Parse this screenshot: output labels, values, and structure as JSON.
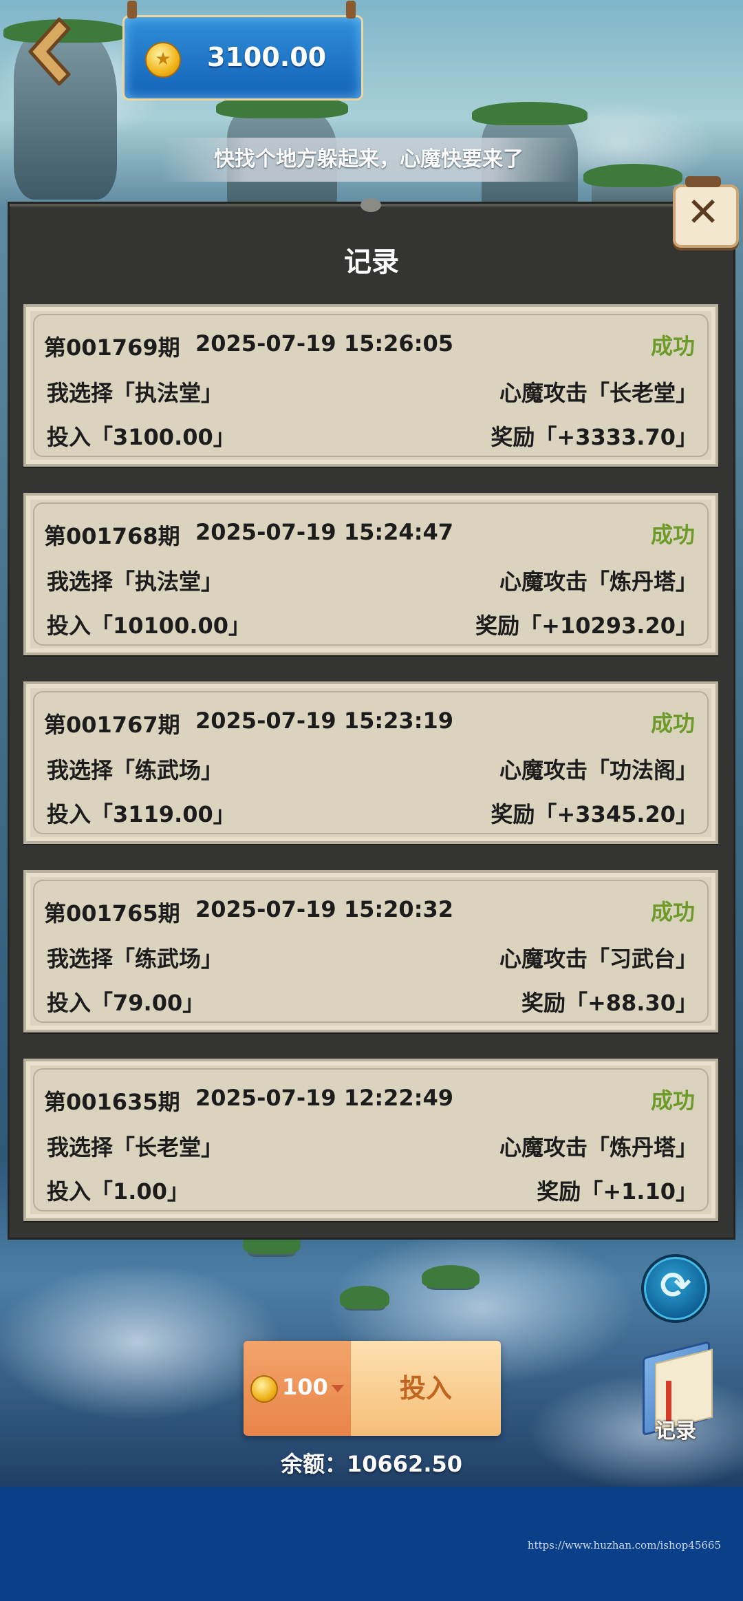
{
  "header": {
    "coin_balance": "3100.00",
    "hint": "快找个地方躲起来，心魔快要来了"
  },
  "panel": {
    "title": "记录",
    "close_label": "✕"
  },
  "records": [
    {
      "period": "第001769期",
      "time": "2025-07-19 15:26:05",
      "status": "成功",
      "choice": "我选择「执法堂」",
      "attack": "心魔攻击「长老堂」",
      "bet": "投入「3100.00」",
      "reward": "奖励「+3333.70」"
    },
    {
      "period": "第001768期",
      "time": "2025-07-19 15:24:47",
      "status": "成功",
      "choice": "我选择「执法堂」",
      "attack": "心魔攻击「炼丹塔」",
      "bet": "投入「10100.00」",
      "reward": "奖励「+10293.20」"
    },
    {
      "period": "第001767期",
      "time": "2025-07-19 15:23:19",
      "status": "成功",
      "choice": "我选择「练武场」",
      "attack": "心魔攻击「功法阁」",
      "bet": "投入「3119.00」",
      "reward": "奖励「+3345.20」"
    },
    {
      "period": "第001765期",
      "time": "2025-07-19 15:20:32",
      "status": "成功",
      "choice": "我选择「练武场」",
      "attack": "心魔攻击「习武台」",
      "bet": "投入「79.00」",
      "reward": "奖励「+88.30」"
    },
    {
      "period": "第001635期",
      "time": "2025-07-19 12:22:49",
      "status": "成功",
      "choice": "我选择「长老堂」",
      "attack": "心魔攻击「炼丹塔」",
      "bet": "投入「1.00」",
      "reward": "奖励「+1.10」"
    }
  ],
  "controls": {
    "bet_amount": "100",
    "bet_button": "投入",
    "balance": "余额：10662.50",
    "record_button": "记录"
  },
  "colors": {
    "status_success": "#6e9a2a",
    "card_bg": "#dad4bf",
    "panel_bg": "#343433",
    "bottom_band": "#0a3f8a"
  },
  "icons": {
    "back": "chevron-left-icon",
    "coin": "coin-icon",
    "close": "close-icon",
    "refresh": "refresh-icon",
    "record_book": "book-icon"
  },
  "watermark": "https://www.huzhan.com/ishop45665"
}
